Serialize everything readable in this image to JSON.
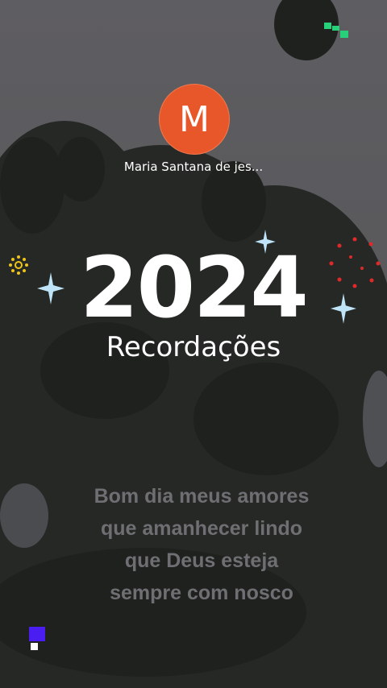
{
  "profile": {
    "avatar_letter": "M",
    "avatar_color": "#e8572a",
    "name": "Maria Santana de jes..."
  },
  "recap": {
    "year": "2024",
    "title": "Recordações"
  },
  "message": {
    "lines": [
      "Bom dia meus amores",
      "que amanhecer lindo",
      "que Deus esteja",
      "sempre com nosco"
    ]
  }
}
